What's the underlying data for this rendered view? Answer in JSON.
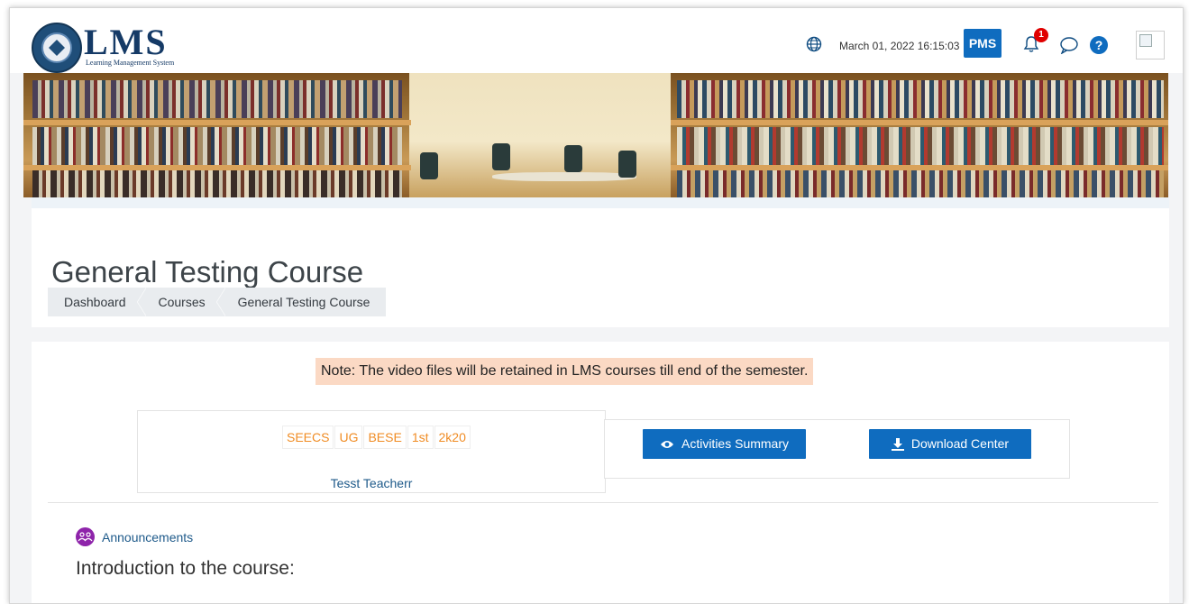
{
  "header": {
    "logo_text": "LMS",
    "logo_subtitle": "Learning Management System",
    "datetime": "March 01, 2022 16:15:03",
    "pms_label": "PMS",
    "notification_count": "1",
    "help_symbol": "?"
  },
  "course": {
    "title": "General Testing Course",
    "breadcrumb": [
      "Dashboard",
      "Courses",
      "General Testing Course"
    ]
  },
  "main": {
    "note": "Note: The video files will be retained in LMS courses till end of the semester.",
    "tags": [
      "SEECS",
      "UG",
      "BESE",
      "1st",
      "2k20"
    ],
    "teacher": "Tesst Teacherr",
    "activities_button": "Activities Summary",
    "download_button": "Download Center",
    "announcements_label": "Announcements",
    "intro_heading": "Introduction to the course:"
  },
  "colors": {
    "primary": "#0f6cbf",
    "note_bg": "#fbd9c4",
    "tag_text": "#f08c24",
    "badge": "#e00000",
    "announce_icon": "#8e24aa"
  },
  "icons": [
    "globe-icon",
    "bell-icon",
    "chat-icon",
    "help-icon",
    "eye-icon",
    "download-icon",
    "announcements-icon"
  ]
}
